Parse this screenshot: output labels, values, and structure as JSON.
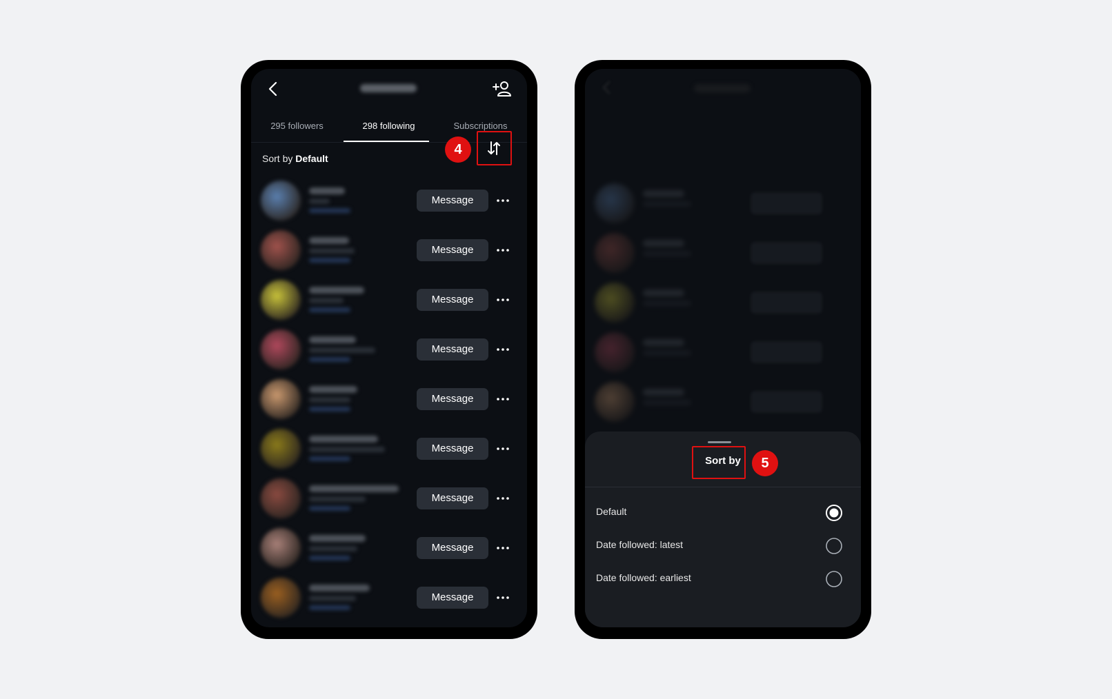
{
  "left_phone": {
    "tabs": [
      {
        "label": "295 followers"
      },
      {
        "label": "298 following"
      },
      {
        "label": "Subscriptions"
      }
    ],
    "active_tab": "298 following",
    "sort": {
      "prefix": "Sort by",
      "value": "Default"
    },
    "step_badge": "4",
    "list": {
      "message_label": "Message",
      "rows": [
        {
          "avatar_color": "#5a7fae"
        },
        {
          "avatar_color": "#a0524c"
        },
        {
          "avatar_color": "#c8c23a"
        },
        {
          "avatar_color": "#b0485c"
        },
        {
          "avatar_color": "#c9986e"
        },
        {
          "avatar_color": "#8a7a1a"
        },
        {
          "avatar_color": "#8a4a40"
        },
        {
          "avatar_color": "#a88078"
        },
        {
          "avatar_color": "#9a5f20"
        }
      ]
    }
  },
  "right_phone": {
    "step_badge": "5",
    "sheet": {
      "title": "Sort by",
      "options": [
        {
          "label": "Default",
          "selected": true
        },
        {
          "label": "Date followed: latest",
          "selected": false
        },
        {
          "label": "Date followed: earliest",
          "selected": false
        }
      ]
    }
  },
  "colors": {
    "highlight": "#e01111",
    "background": "#f1f2f4",
    "screen": "#0c0f14",
    "sheet": "#1a1d22",
    "button": "#2a2f37"
  }
}
